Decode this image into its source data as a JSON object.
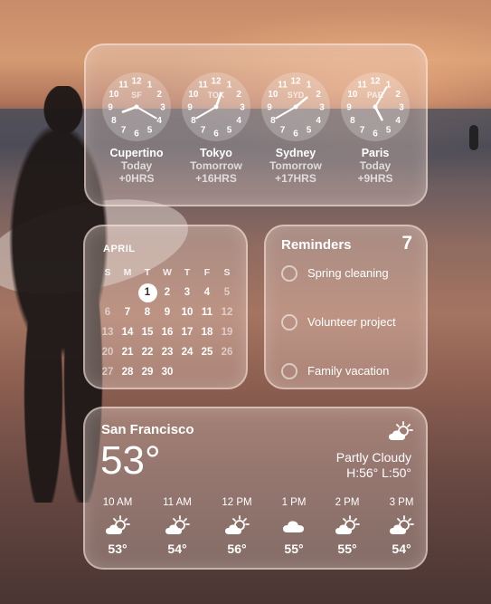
{
  "clocks": [
    {
      "abbr": "SF",
      "city": "Cupertino",
      "day": "Today",
      "offset": "+0HRS",
      "hour": 8,
      "minute": 20
    },
    {
      "abbr": "TOK",
      "city": "Tokyo",
      "day": "Tomorrow",
      "offset": "+16HRS",
      "hour": 0,
      "minute": 40
    },
    {
      "abbr": "SYD",
      "city": "Sydney",
      "day": "Tomorrow",
      "offset": "+17HRS",
      "hour": 1,
      "minute": 40
    },
    {
      "abbr": "PAR",
      "city": "Paris",
      "day": "Today",
      "offset": "+9HRS",
      "hour": 5,
      "minute": 5
    }
  ],
  "calendar": {
    "month": "APRIL",
    "weekdays": [
      "S",
      "M",
      "T",
      "W",
      "T",
      "F",
      "S"
    ],
    "today": "1",
    "weeks": [
      [
        "",
        "",
        "1",
        "2",
        "3",
        "4",
        "5"
      ],
      [
        "6",
        "7",
        "8",
        "9",
        "10",
        "11",
        "12"
      ],
      [
        "13",
        "14",
        "15",
        "16",
        "17",
        "18",
        "19"
      ],
      [
        "20",
        "21",
        "22",
        "23",
        "24",
        "25",
        "26"
      ],
      [
        "27",
        "28",
        "29",
        "30",
        "",
        "",
        ""
      ]
    ]
  },
  "reminders": {
    "title": "Reminders",
    "count": "7",
    "items": [
      "Spring cleaning",
      "Volunteer project",
      "Family vacation"
    ]
  },
  "weather": {
    "city": "San Francisco",
    "temp": "53°",
    "condition": "Partly Cloudy",
    "hilo": "H:56° L:50°",
    "icon": "partly-cloudy-icon",
    "hourly": [
      {
        "time": "10 AM",
        "icon": "partly-cloudy-icon",
        "temp": "53°"
      },
      {
        "time": "11 AM",
        "icon": "partly-cloudy-icon",
        "temp": "54°"
      },
      {
        "time": "12 PM",
        "icon": "partly-cloudy-icon",
        "temp": "56°"
      },
      {
        "time": "1 PM",
        "icon": "cloud-icon",
        "temp": "55°"
      },
      {
        "time": "2 PM",
        "icon": "partly-cloudy-icon",
        "temp": "55°"
      },
      {
        "time": "3 PM",
        "icon": "partly-cloudy-icon",
        "temp": "54°"
      }
    ]
  }
}
